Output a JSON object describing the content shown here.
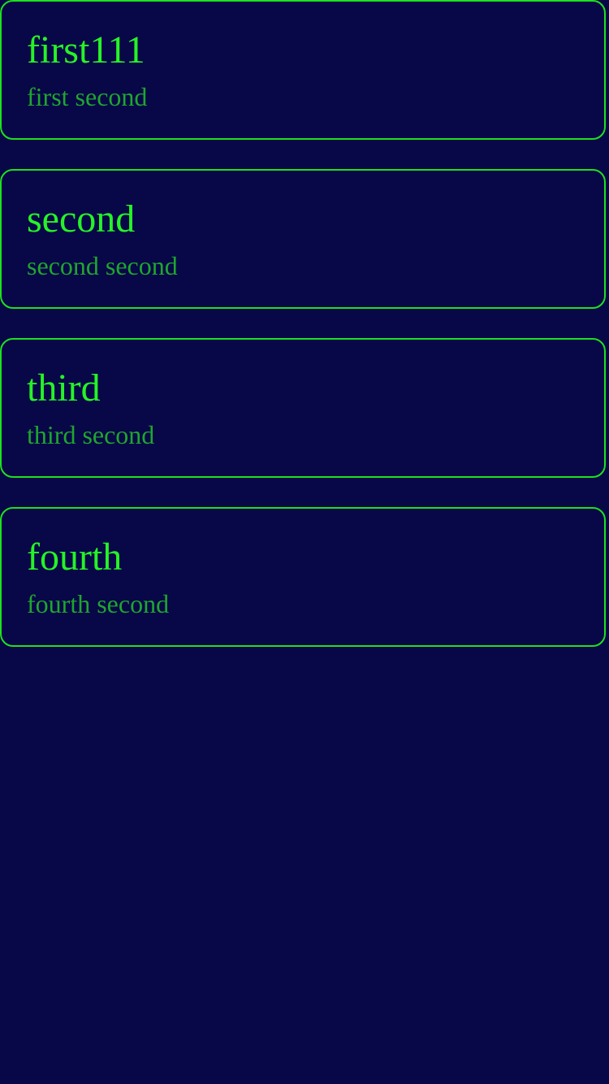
{
  "colors": {
    "background": "#080748",
    "border": "#1ee11e",
    "title": "#26f326",
    "subtitle": "#1fa62d"
  },
  "cards": [
    {
      "title": "first111",
      "subtitle": "first second"
    },
    {
      "title": "second",
      "subtitle": "second second"
    },
    {
      "title": "third",
      "subtitle": "third second"
    },
    {
      "title": "fourth",
      "subtitle": "fourth second"
    }
  ]
}
